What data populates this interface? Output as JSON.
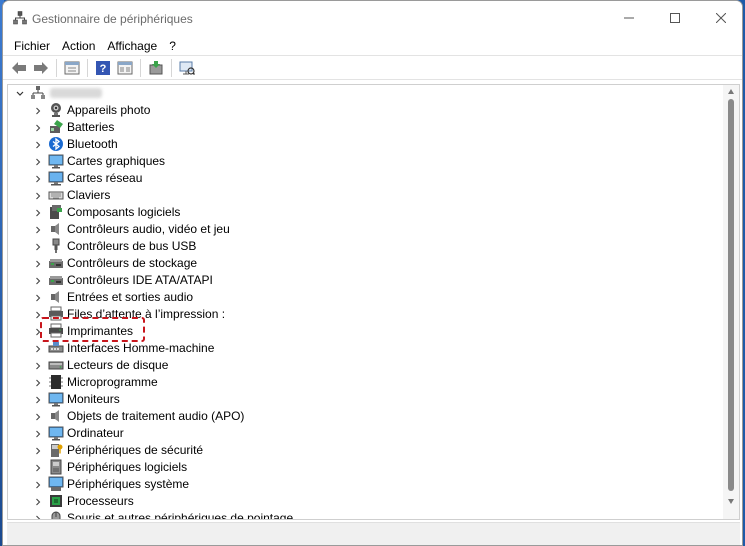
{
  "window": {
    "title": "Gestionnaire de périphériques",
    "controls": {
      "minimize": "minimize-icon",
      "maximize": "maximize-icon",
      "close": "close-icon"
    }
  },
  "menubar": [
    {
      "label": "Fichier"
    },
    {
      "label": "Action"
    },
    {
      "label": "Affichage"
    },
    {
      "label": "?"
    }
  ],
  "toolbar": [
    {
      "icon": "back-arrow-icon"
    },
    {
      "icon": "forward-arrow-icon"
    },
    {
      "icon": "properties-icon"
    },
    {
      "icon": "help-icon"
    },
    {
      "icon": "view-icon"
    },
    {
      "icon": "update-driver-icon"
    },
    {
      "icon": "scan-hardware-icon"
    }
  ],
  "tree": {
    "root_label": "",
    "items": [
      {
        "label": "Appareils photo",
        "icon": "camera-icon"
      },
      {
        "label": "Batteries",
        "icon": "battery-icon"
      },
      {
        "label": "Bluetooth",
        "icon": "bluetooth-icon"
      },
      {
        "label": "Cartes graphiques",
        "icon": "display-adapter-icon"
      },
      {
        "label": "Cartes réseau",
        "icon": "network-adapter-icon"
      },
      {
        "label": "Claviers",
        "icon": "keyboard-icon"
      },
      {
        "label": "Composants logiciels",
        "icon": "software-component-icon"
      },
      {
        "label": "Contrôleurs audio, vidéo et jeu",
        "icon": "audio-video-icon"
      },
      {
        "label": "Contrôleurs de bus USB",
        "icon": "usb-icon"
      },
      {
        "label": "Contrôleurs de stockage",
        "icon": "storage-controller-icon"
      },
      {
        "label": "Contrôleurs IDE ATA/ATAPI",
        "icon": "ide-controller-icon"
      },
      {
        "label": "Entrées et sorties audio",
        "icon": "audio-io-icon"
      },
      {
        "label": "Files d’attente à l’impression :",
        "icon": "print-queue-icon"
      },
      {
        "label": "Imprimantes",
        "icon": "printer-icon"
      },
      {
        "label": "Interfaces Homme-machine",
        "icon": "hid-icon"
      },
      {
        "label": "Lecteurs de disque",
        "icon": "disk-drive-icon"
      },
      {
        "label": "Microprogramme",
        "icon": "firmware-icon"
      },
      {
        "label": "Moniteurs",
        "icon": "monitor-icon"
      },
      {
        "label": "Objets de traitement audio (APO)",
        "icon": "apo-icon"
      },
      {
        "label": "Ordinateur",
        "icon": "computer-icon"
      },
      {
        "label": "Périphériques de sécurité",
        "icon": "security-device-icon"
      },
      {
        "label": "Périphériques logiciels",
        "icon": "software-device-icon"
      },
      {
        "label": "Périphériques système",
        "icon": "system-device-icon"
      },
      {
        "label": "Processeurs",
        "icon": "processor-icon"
      },
      {
        "label": "Souris et autres périphériques de pointage",
        "icon": "mouse-icon"
      }
    ]
  },
  "highlight": {
    "target": "Imprimantes",
    "color": "#c8161d"
  },
  "colors": {
    "accent": "#1e5aa8",
    "highlight": "#c8161d"
  }
}
